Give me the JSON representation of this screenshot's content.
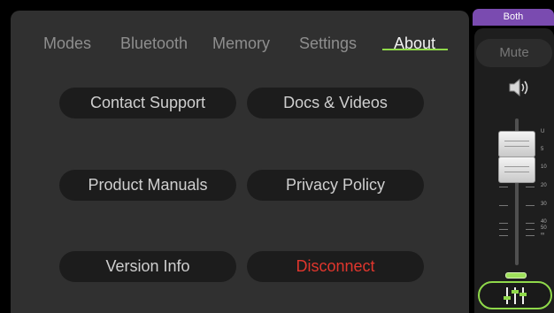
{
  "tabs": [
    {
      "label": "Modes",
      "active": false
    },
    {
      "label": "Bluetooth",
      "active": false
    },
    {
      "label": "Memory",
      "active": false
    },
    {
      "label": "Settings",
      "active": false
    },
    {
      "label": "About",
      "active": true
    }
  ],
  "about_buttons": {
    "contact_support": "Contact Support",
    "docs_videos": "Docs & Videos",
    "product_manuals": "Product Manuals",
    "privacy_policy": "Privacy Policy",
    "version_info": "Version Info",
    "disconnect": "Disconnect"
  },
  "channel_strip": {
    "target": "Both",
    "mute_label": "Mute",
    "scale": [
      "U",
      "5",
      "10",
      "20",
      "30",
      "40",
      "50",
      "∞"
    ],
    "icons": [
      "speaker-icon",
      "mixer-sliders-icon"
    ]
  },
  "colors": {
    "accent": "#8fd94a",
    "target_tab": "#7a4bb0",
    "danger": "#e0362d",
    "panel": "#303030"
  }
}
